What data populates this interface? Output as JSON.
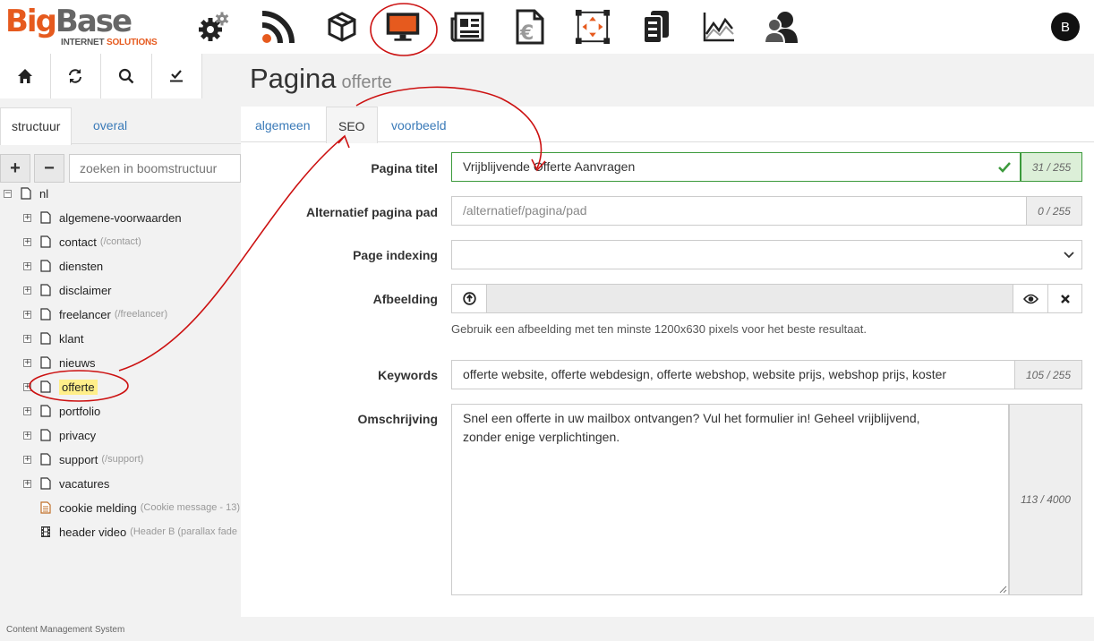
{
  "app": {
    "logo_big": "Big",
    "logo_base": "Base",
    "logo_sub_1": "INTERNET ",
    "logo_sub_2": "SOLUTIONS",
    "avatar": "B",
    "footer": "Content Management System"
  },
  "topnav": [
    "gear-icon",
    "rss-icon",
    "box-icon",
    "monitor-icon",
    "newspaper-icon",
    "euro-doc-icon",
    "resize-icon",
    "server-icon",
    "chart-icon",
    "users-icon"
  ],
  "left": {
    "tabs": {
      "structure": "structuur",
      "overall": "overal"
    },
    "search_placeholder": "zoeken in boomstructuur",
    "root": "nl",
    "items": [
      {
        "label": "algemene-voorwaarden",
        "path": ""
      },
      {
        "label": "contact",
        "path": "(/contact)"
      },
      {
        "label": "diensten",
        "path": ""
      },
      {
        "label": "disclaimer",
        "path": ""
      },
      {
        "label": "freelancer",
        "path": "(/freelancer)"
      },
      {
        "label": "klant",
        "path": ""
      },
      {
        "label": "nieuws",
        "path": ""
      },
      {
        "label": "offerte",
        "path": ""
      },
      {
        "label": "portfolio",
        "path": ""
      },
      {
        "label": "privacy",
        "path": ""
      },
      {
        "label": "support",
        "path": "(/support)"
      },
      {
        "label": "vacatures",
        "path": ""
      }
    ],
    "extra": [
      {
        "label": "cookie melding",
        "path": "(Cookie message - 13)"
      },
      {
        "label": "header video",
        "path": "(Header B (parallax fade"
      }
    ]
  },
  "page": {
    "title": "Pagina",
    "subtitle": "offerte"
  },
  "tabs": {
    "general": "algemeen",
    "seo": "SEO",
    "preview": "voorbeeld"
  },
  "form": {
    "title_label": "Pagina titel",
    "title_value": "Vrijblijvende Offerte Aanvragen",
    "title_count": "31 / 255",
    "altpath_label": "Alternatief pagina pad",
    "altpath_placeholder": "/alternatief/pagina/pad",
    "altpath_count": "0 / 255",
    "indexing_label": "Page indexing",
    "image_label": "Afbeelding",
    "image_help": "Gebruik een afbeelding met ten minste 1200x630 pixels voor het beste resultaat.",
    "keywords_label": "Keywords",
    "keywords_value": "offerte website, offerte webdesign, offerte webshop, website prijs, webshop prijs, koster",
    "keywords_count": "105 / 255",
    "desc_label": "Omschrijving",
    "desc_value": "Snel een offerte in uw mailbox ontvangen? Vul het formulier in! Geheel vrijblijvend,\nzonder enige verplichtingen.",
    "desc_count": "113 / 4000"
  },
  "colors": {
    "accent": "#e65a1e",
    "link": "#3a7ab8",
    "valid": "#3c9a3c",
    "annotation": "#cc1111"
  }
}
